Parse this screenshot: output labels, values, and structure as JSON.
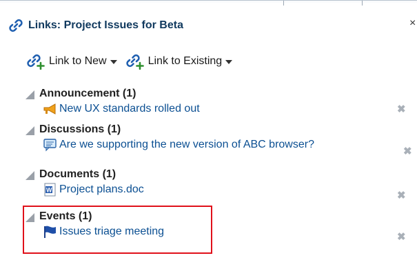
{
  "panel": {
    "title": "Links: Project Issues for Beta",
    "close_glyph": "×"
  },
  "toolbar": {
    "link_new_label": "Link to New",
    "link_existing_label": "Link to Existing"
  },
  "groups": [
    {
      "title": "Announcement (1)",
      "item": "New UX standards rolled out",
      "icon": "megaphone-icon"
    },
    {
      "title": "Discussions (1)",
      "item": "Are we supporting the new version of ABC browser?",
      "icon": "discussion-icon"
    },
    {
      "title": "Documents (1)",
      "item": "Project plans.doc",
      "icon": "word-document-icon"
    },
    {
      "title": "Events (1)",
      "item": "Issues triage meeting",
      "icon": "flag-icon"
    }
  ],
  "delete_glyph": "✖",
  "colors": {
    "title": "#10395e",
    "link": "#0b4f92",
    "highlight": "#e0101a",
    "delete": "#a9b0b8"
  }
}
